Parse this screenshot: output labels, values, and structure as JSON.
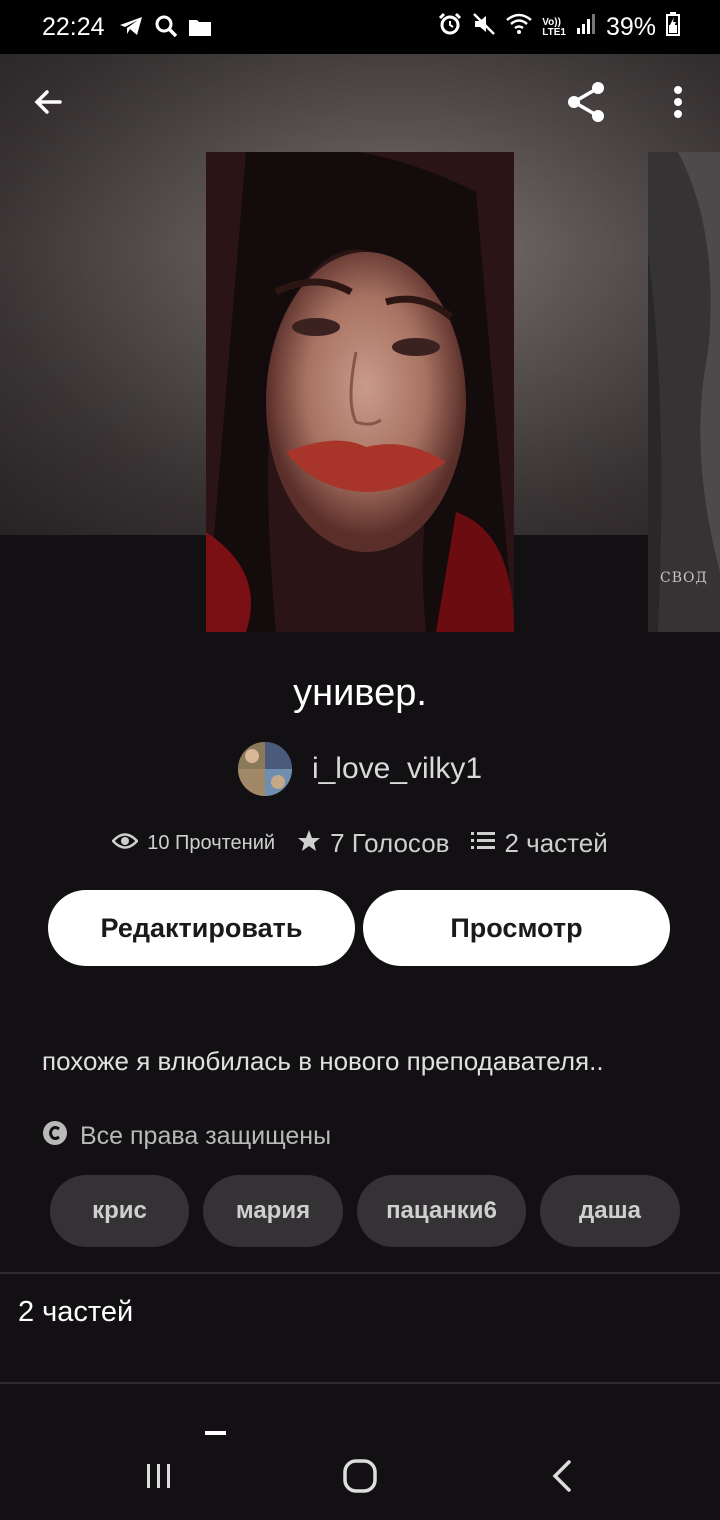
{
  "status_bar": {
    "time": "22:24",
    "left_icons": [
      "telegram-icon",
      "search-icon",
      "folder-icon"
    ],
    "right_icons": [
      "alarm-icon",
      "mute-icon",
      "wifi-icon",
      "volte-lte-icon",
      "signal-icon"
    ],
    "volte_text": "Vo))",
    "lte_text": "LTE1",
    "battery": "39%"
  },
  "top_bar": {
    "back_icon": "arrow-left-icon",
    "share_icon": "share-icon",
    "more_icon": "more-vert-icon"
  },
  "covers": {
    "side_cover_text": "СВОД"
  },
  "story": {
    "title": "универ.",
    "author": "i_love_vilky1",
    "reads": "10 Прочтений",
    "votes": "7 Голосов",
    "parts_count": "2 частей",
    "description": "похоже я влюбилась в нового преподавателя..",
    "rights": "Все права защищены"
  },
  "buttons": {
    "edit": "Редактировать",
    "preview": "Просмотр"
  },
  "tags": [
    "крис",
    "мария",
    "пацанки6",
    "даша"
  ],
  "parts_section": {
    "label": "2 частей"
  },
  "nav_bar": {
    "recent_icon": "recent-apps-icon",
    "home_icon": "home-icon",
    "back_icon": "back-nav-icon"
  }
}
